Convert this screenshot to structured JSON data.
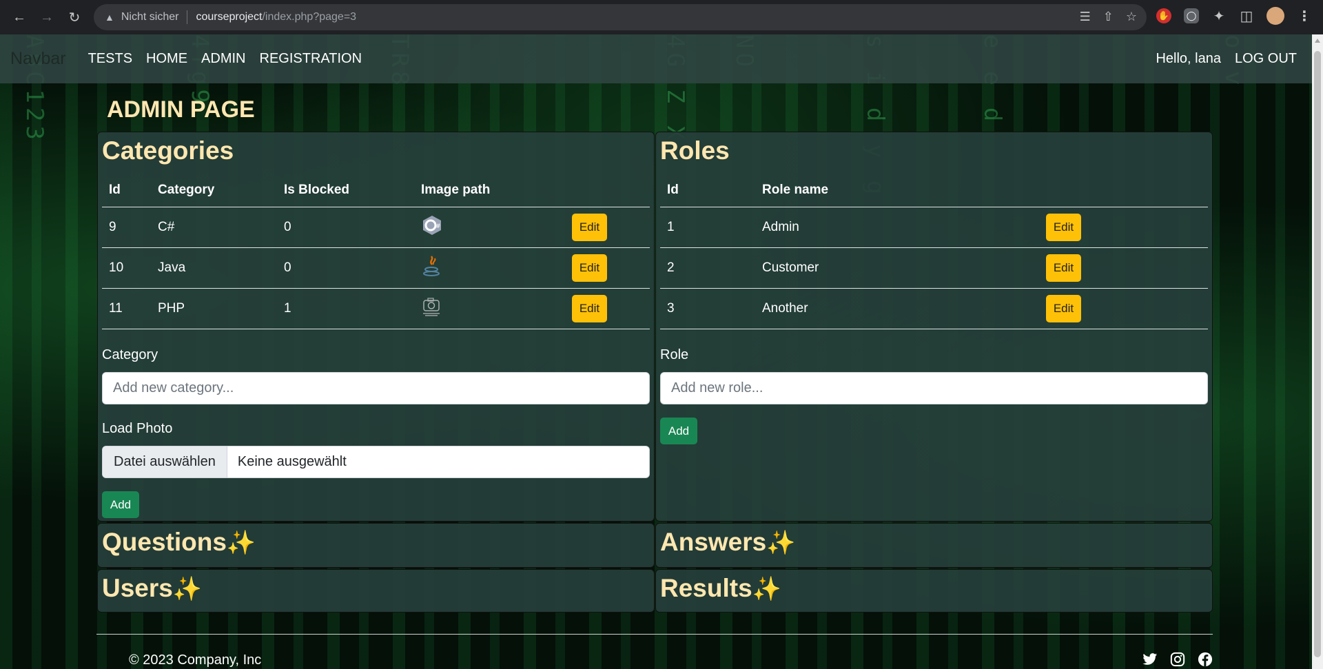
{
  "browser": {
    "security_label": "Nicht sicher",
    "url_host": "courseproject",
    "url_path": "/index.php?page=3"
  },
  "navbar": {
    "brand": "Navbar",
    "links": [
      "TESTS",
      "HOME",
      "ADMIN",
      "REGISTRATION"
    ],
    "greeting": "Hello, lana",
    "logout": "LOG OUT"
  },
  "page_title": "ADMIN PAGE",
  "categories": {
    "title": "Categories",
    "headers": [
      "Id",
      "Category",
      "Is Blocked",
      "Image path"
    ],
    "rows": [
      {
        "id": "9",
        "category": "C#",
        "is_blocked": "0",
        "icon": "csharp-logo-icon"
      },
      {
        "id": "10",
        "category": "Java",
        "is_blocked": "0",
        "icon": "java-logo-icon"
      },
      {
        "id": "11",
        "category": "PHP",
        "is_blocked": "1",
        "icon": "no-image-camera-icon"
      }
    ],
    "edit_label": "Edit",
    "category_label": "Category",
    "category_placeholder": "Add new category...",
    "photo_label": "Load Photo",
    "file_button": "Datei auswählen",
    "file_status": "Keine ausgewählt",
    "add_label": "Add"
  },
  "roles": {
    "title": "Roles",
    "headers": [
      "Id",
      "Role name"
    ],
    "rows": [
      {
        "id": "1",
        "name": "Admin"
      },
      {
        "id": "2",
        "name": "Customer"
      },
      {
        "id": "3",
        "name": "Another"
      }
    ],
    "edit_label": "Edit",
    "role_label": "Role",
    "role_placeholder": "Add new role...",
    "add_label": "Add"
  },
  "sections": {
    "questions": "Questions",
    "answers": "Answers",
    "users": "Users",
    "results": "Results"
  },
  "footer": {
    "copyright": "© 2023 Company, Inc",
    "social_icons": [
      "twitter-icon",
      "instagram-icon",
      "facebook-icon"
    ]
  },
  "colors": {
    "accent_title": "#ffe7b0",
    "edit_button": "#ffc107",
    "add_button": "#198754",
    "card_bg": "#263e3a"
  }
}
